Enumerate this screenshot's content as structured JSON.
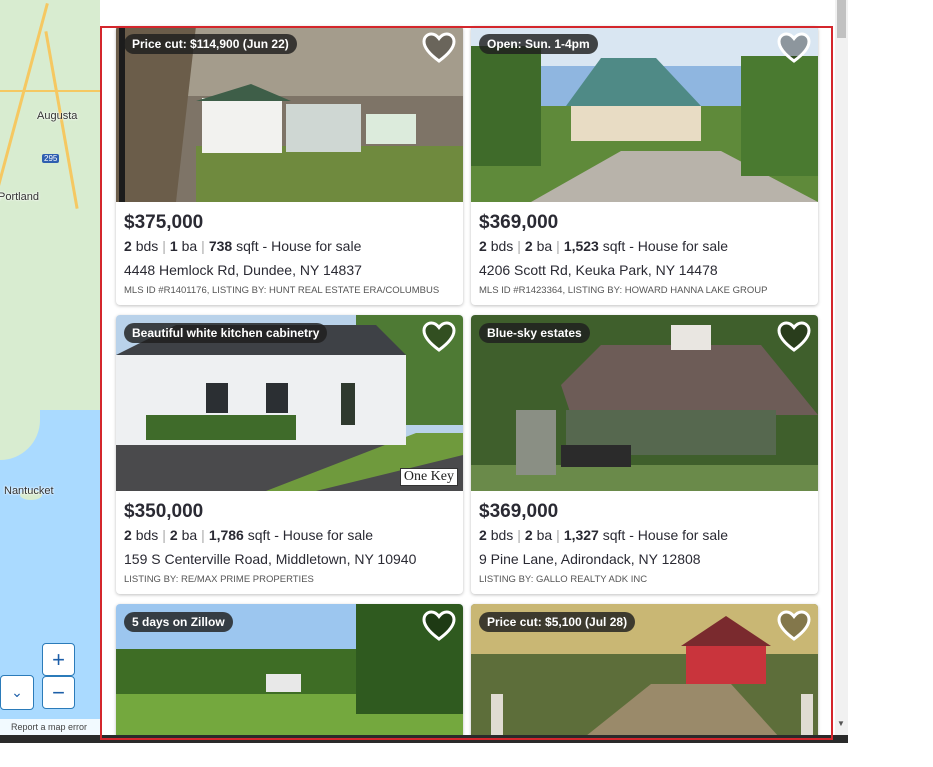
{
  "map": {
    "labels": [
      "Augusta",
      "Portland",
      "Nantucket"
    ],
    "highway": "295",
    "zoom_in": "+",
    "zoom_out": "−",
    "control_icon": "⌄",
    "footer": "Report a map error"
  },
  "listings": [
    {
      "badge": "Price cut: $114,900 (Jun 22)",
      "price": "$375,000",
      "beds": "2",
      "beds_unit": "bds",
      "baths": "1",
      "baths_unit": "ba",
      "sqft": "738",
      "sqft_unit": "sqft",
      "type": "- House for sale",
      "address": "4448 Hemlock Rd, Dundee, NY 14837",
      "mls": "MLS ID #R1401176, LISTING BY: HUNT REAL ESTATE ERA/COLUMBUS"
    },
    {
      "badge": "Open: Sun. 1-4pm",
      "price": "$369,000",
      "beds": "2",
      "beds_unit": "bds",
      "baths": "2",
      "baths_unit": "ba",
      "sqft": "1,523",
      "sqft_unit": "sqft",
      "type": "- House for sale",
      "address": "4206 Scott Rd, Keuka Park, NY 14478",
      "mls": "MLS ID #R1423364, LISTING BY: HOWARD HANNA LAKE GROUP"
    },
    {
      "badge": "Beautiful white kitchen cabinetry",
      "price": "$350,000",
      "beds": "2",
      "beds_unit": "bds",
      "baths": "2",
      "baths_unit": "ba",
      "sqft": "1,786",
      "sqft_unit": "sqft",
      "type": "- House for sale",
      "address": "159 S Centerville Road, Middletown, NY 10940",
      "mls": "LISTING BY: RE/MAX PRIME PROPERTIES",
      "logo": "One Key"
    },
    {
      "badge": "Blue-sky estates",
      "price": "$369,000",
      "beds": "2",
      "beds_unit": "bds",
      "baths": "2",
      "baths_unit": "ba",
      "sqft": "1,327",
      "sqft_unit": "sqft",
      "type": "- House for sale",
      "address": "9 Pine Lane, Adirondack, NY 12808",
      "mls": "LISTING BY: GALLO REALTY ADK INC"
    },
    {
      "badge": "5 days on Zillow"
    },
    {
      "badge": "Price cut: $5,100 (Jul 28)"
    }
  ],
  "colors": {
    "text": "#2a2a33",
    "highlight": "#d4262c",
    "badge_bg": "#1e1e1e",
    "water": "#aadaff"
  },
  "icons": [
    "heart-outline-icon",
    "plus-icon",
    "minus-icon",
    "chevron-down-icon"
  ]
}
